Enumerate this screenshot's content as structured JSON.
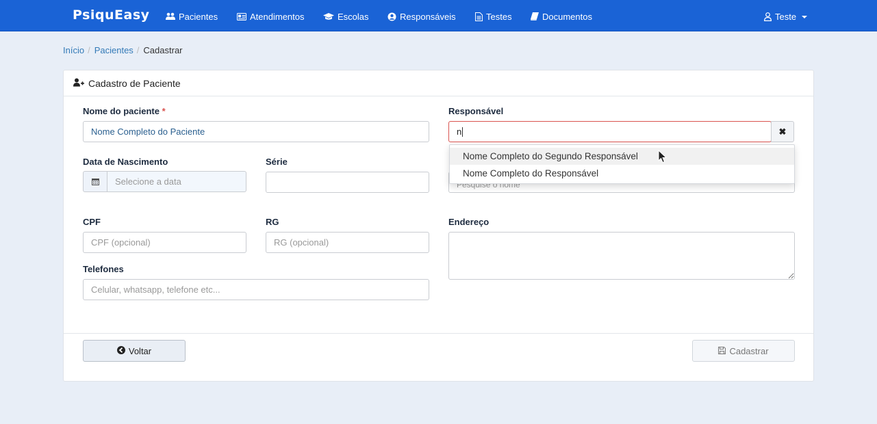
{
  "navbar": {
    "brand": "PsiquEasy",
    "items": [
      {
        "label": "Pacientes",
        "icon": "users-icon"
      },
      {
        "label": "Atendimentos",
        "icon": "id-card-icon"
      },
      {
        "label": "Escolas",
        "icon": "graduation-cap-icon"
      },
      {
        "label": "Responsáveis",
        "icon": "user-circle-icon"
      },
      {
        "label": "Testes",
        "icon": "file-text-icon"
      },
      {
        "label": "Documentos",
        "icon": "book-icon"
      }
    ],
    "user": {
      "label": "Teste",
      "icon": "user-icon"
    }
  },
  "breadcrumb": {
    "items": [
      "Início",
      "Pacientes",
      "Cadastrar"
    ]
  },
  "panel": {
    "title": "Cadastro de Paciente"
  },
  "form": {
    "nome": {
      "label": "Nome do paciente",
      "required_mark": "*",
      "value": "Nome Completo do Paciente"
    },
    "responsavel": {
      "label": "Responsável",
      "value": "n",
      "hidden_placeholder": "Pesquise o nome"
    },
    "nascimento": {
      "label": "Data de Nascimento",
      "placeholder": "Selecione a data"
    },
    "serie": {
      "label": "Série",
      "value": ""
    },
    "cpf": {
      "label": "CPF",
      "placeholder": "CPF (opcional)"
    },
    "rg": {
      "label": "RG",
      "placeholder": "RG (opcional)"
    },
    "endereco": {
      "label": "Endereço",
      "value": ""
    },
    "telefones": {
      "label": "Telefones",
      "placeholder": "Celular, whatsapp, telefone etc..."
    }
  },
  "autocomplete": {
    "options": [
      "Nome Completo do Segundo Responsável",
      "Nome Completo do Responsável"
    ],
    "highlighted_index": 0
  },
  "buttons": {
    "back": "Voltar",
    "save": "Cadastrar"
  },
  "colors": {
    "navbar": "#1a63d6",
    "page_bg": "#e8eef7",
    "required": "#d9534f",
    "link": "#337ab7"
  }
}
